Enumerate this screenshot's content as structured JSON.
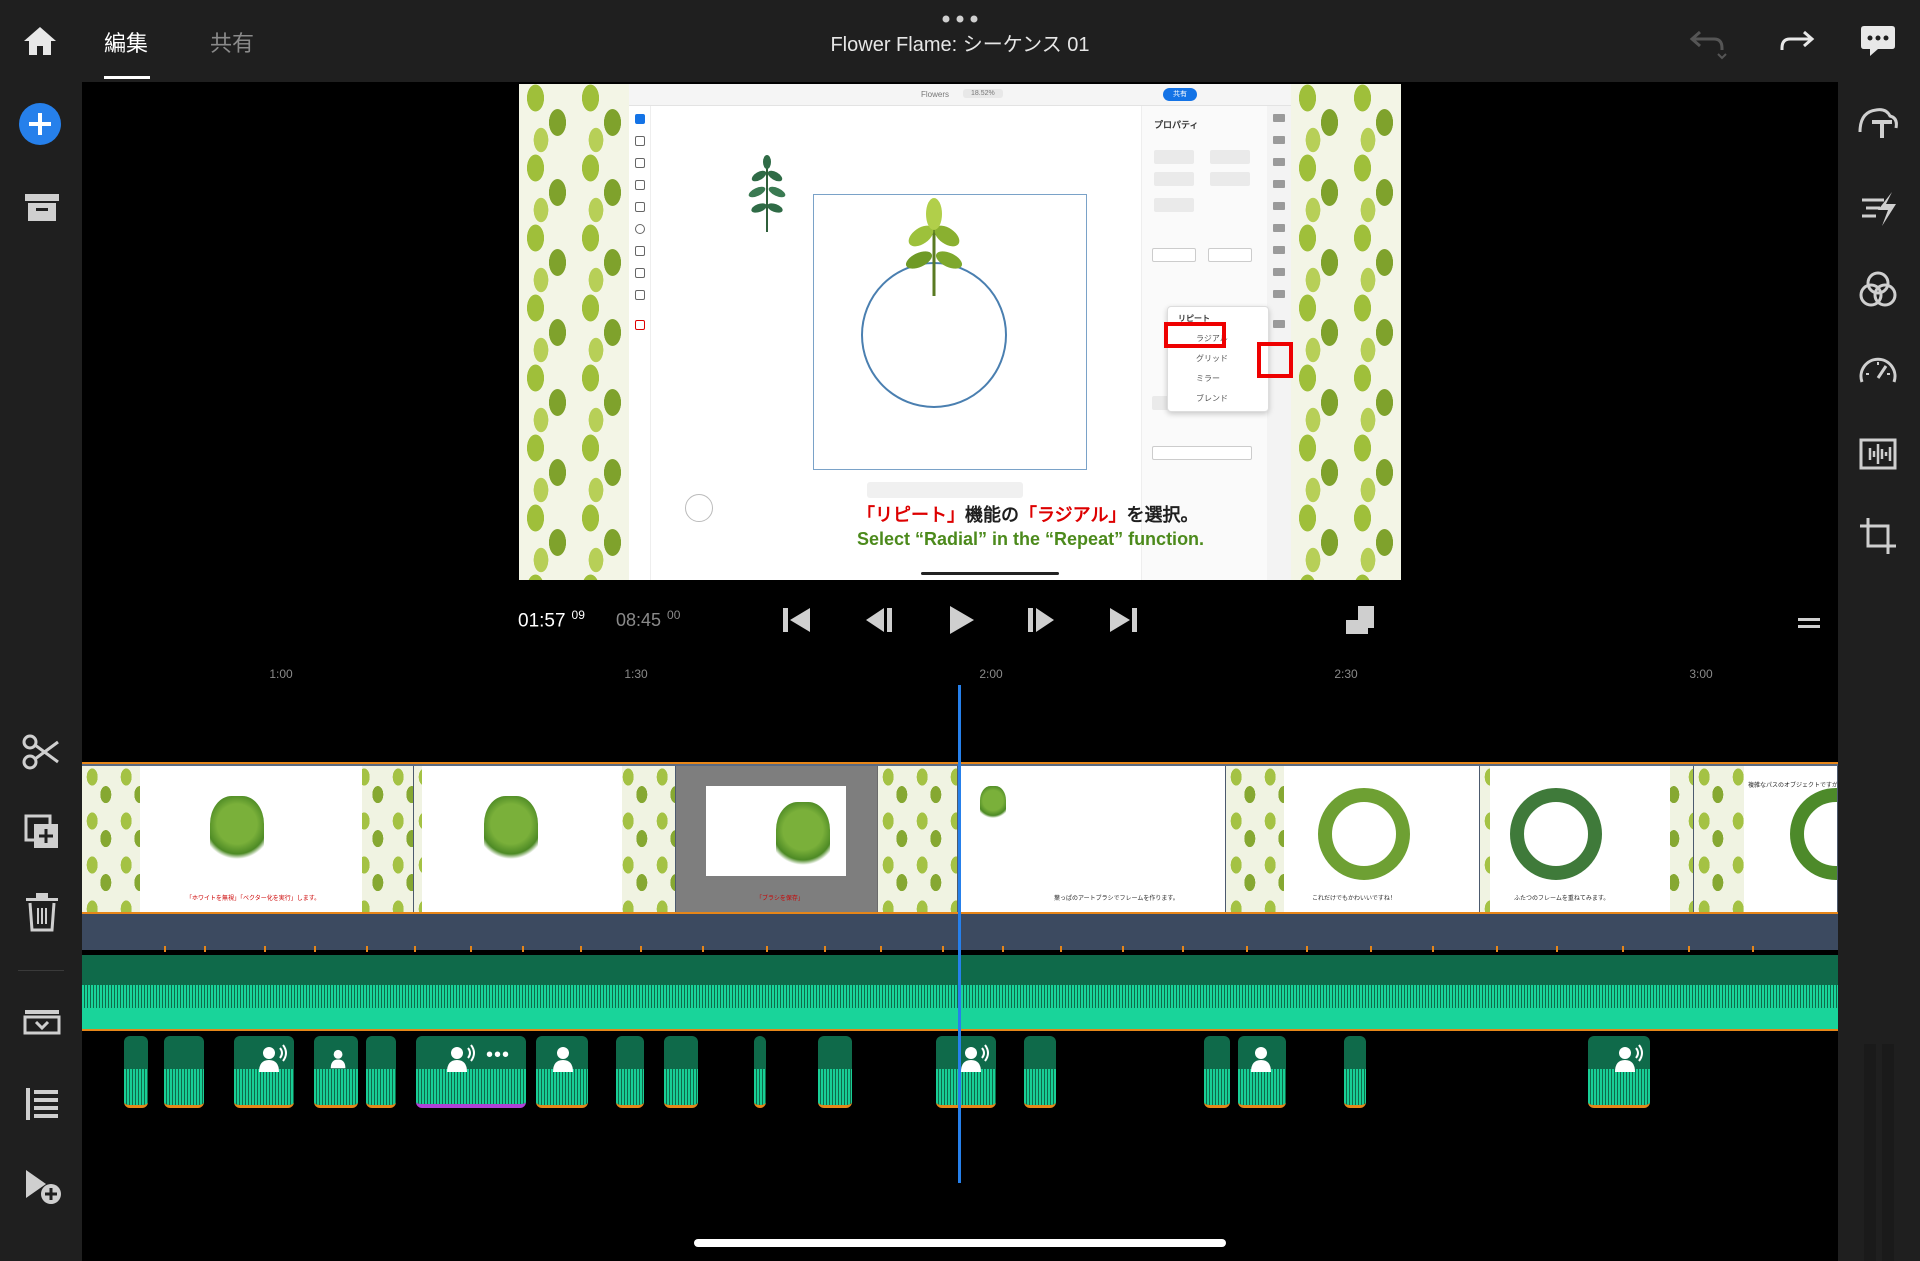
{
  "header": {
    "tabs": [
      {
        "label": "編集",
        "active": true
      },
      {
        "label": "共有",
        "active": false
      }
    ],
    "title": "Flower Flame: シーケンス 01"
  },
  "left_toolbar": [
    {
      "name": "add-media-button",
      "icon": "plus-circle-icon"
    },
    {
      "name": "media-bin-button",
      "icon": "archive-box-icon"
    },
    {
      "name": "split-button",
      "icon": "scissors-icon"
    },
    {
      "name": "duplicate-button",
      "icon": "duplicate-icon"
    },
    {
      "name": "delete-button",
      "icon": "trash-icon"
    },
    {
      "name": "track-view-button",
      "icon": "track-list-icon"
    },
    {
      "name": "list-view-button",
      "icon": "list-icon"
    },
    {
      "name": "add-clip-button",
      "icon": "add-to-timeline-icon"
    }
  ],
  "right_toolbar": [
    {
      "name": "title-button",
      "icon": "text-overlay-icon"
    },
    {
      "name": "transition-button",
      "icon": "transition-icon"
    },
    {
      "name": "color-button",
      "icon": "color-circles-icon"
    },
    {
      "name": "speed-button",
      "icon": "speedometer-icon"
    },
    {
      "name": "audio-button",
      "icon": "audio-waveform-icon"
    },
    {
      "name": "crop-button",
      "icon": "crop-icon"
    }
  ],
  "preview": {
    "app_doc_title": "Flowers",
    "zoom": "18.52%",
    "share_label": "共有",
    "panel_title": "プロパティ",
    "popup": {
      "title": "リピート",
      "items": [
        "ラジアル",
        "グリッド",
        "ミラー",
        "ブレンド"
      ]
    },
    "caption_jp_parts": [
      {
        "text": "「リピート」",
        "red": true
      },
      {
        "text": "機能の",
        "red": false
      },
      {
        "text": "「ラジアル」",
        "red": true
      },
      {
        "text": "を選択。",
        "red": false
      }
    ],
    "caption_en": "Select “Radial” in the “Repeat” function."
  },
  "transport": {
    "current_time": "01:57",
    "current_frames": "09",
    "total_time": "08:45",
    "total_frames": "00"
  },
  "ruler": [
    "1:00",
    "1:30",
    "2:00",
    "2:30",
    "3:00"
  ],
  "video_thumbs": [
    {
      "caption": "「ホワイトを無視」「ベクター化を実行」します。"
    },
    {
      "caption": ""
    },
    {
      "caption": "「ブラシを保存」"
    },
    {
      "caption": ""
    },
    {
      "caption": "葉っぱのアートブラシでフレームを作ります。"
    },
    {
      "caption": "これだけでもかわいいですね！"
    },
    {
      "caption": "ふたつのフレームを重ねてみます。"
    },
    {
      "caption": "複雑なパスのオブジェクトですが"
    }
  ],
  "colors": {
    "accent_blue": "#2680eb",
    "track_orange": "#e68619",
    "audio_green": "#19d49a",
    "selected_clip": "#b23fd8"
  }
}
